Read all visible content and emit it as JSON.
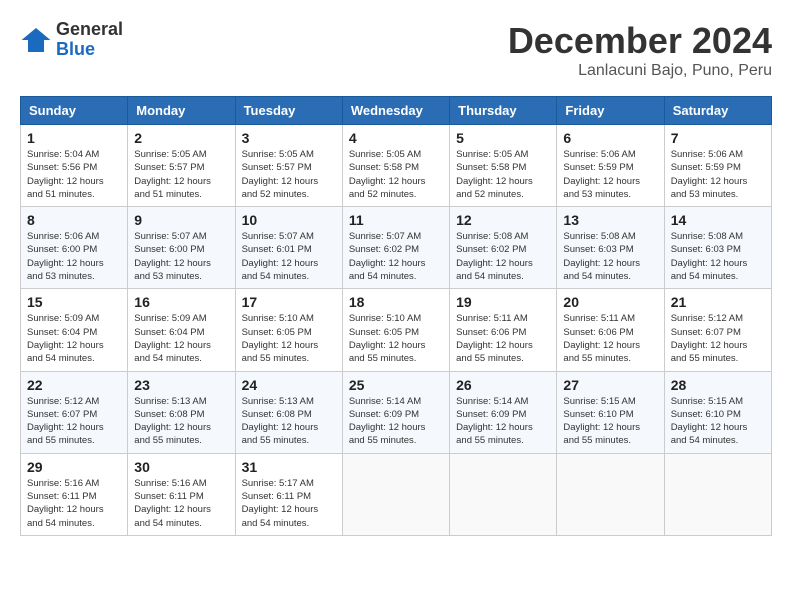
{
  "logo": {
    "general": "General",
    "blue": "Blue"
  },
  "header": {
    "month": "December 2024",
    "location": "Lanlacuni Bajo, Puno, Peru"
  },
  "weekdays": [
    "Sunday",
    "Monday",
    "Tuesday",
    "Wednesday",
    "Thursday",
    "Friday",
    "Saturday"
  ],
  "weeks": [
    [
      {
        "day": "1",
        "sunrise": "5:04 AM",
        "sunset": "5:56 PM",
        "daylight": "12 hours and 51 minutes."
      },
      {
        "day": "2",
        "sunrise": "5:05 AM",
        "sunset": "5:57 PM",
        "daylight": "12 hours and 51 minutes."
      },
      {
        "day": "3",
        "sunrise": "5:05 AM",
        "sunset": "5:57 PM",
        "daylight": "12 hours and 52 minutes."
      },
      {
        "day": "4",
        "sunrise": "5:05 AM",
        "sunset": "5:58 PM",
        "daylight": "12 hours and 52 minutes."
      },
      {
        "day": "5",
        "sunrise": "5:05 AM",
        "sunset": "5:58 PM",
        "daylight": "12 hours and 52 minutes."
      },
      {
        "day": "6",
        "sunrise": "5:06 AM",
        "sunset": "5:59 PM",
        "daylight": "12 hours and 53 minutes."
      },
      {
        "day": "7",
        "sunrise": "5:06 AM",
        "sunset": "5:59 PM",
        "daylight": "12 hours and 53 minutes."
      }
    ],
    [
      {
        "day": "8",
        "sunrise": "5:06 AM",
        "sunset": "6:00 PM",
        "daylight": "12 hours and 53 minutes."
      },
      {
        "day": "9",
        "sunrise": "5:07 AM",
        "sunset": "6:00 PM",
        "daylight": "12 hours and 53 minutes."
      },
      {
        "day": "10",
        "sunrise": "5:07 AM",
        "sunset": "6:01 PM",
        "daylight": "12 hours and 54 minutes."
      },
      {
        "day": "11",
        "sunrise": "5:07 AM",
        "sunset": "6:02 PM",
        "daylight": "12 hours and 54 minutes."
      },
      {
        "day": "12",
        "sunrise": "5:08 AM",
        "sunset": "6:02 PM",
        "daylight": "12 hours and 54 minutes."
      },
      {
        "day": "13",
        "sunrise": "5:08 AM",
        "sunset": "6:03 PM",
        "daylight": "12 hours and 54 minutes."
      },
      {
        "day": "14",
        "sunrise": "5:08 AM",
        "sunset": "6:03 PM",
        "daylight": "12 hours and 54 minutes."
      }
    ],
    [
      {
        "day": "15",
        "sunrise": "5:09 AM",
        "sunset": "6:04 PM",
        "daylight": "12 hours and 54 minutes."
      },
      {
        "day": "16",
        "sunrise": "5:09 AM",
        "sunset": "6:04 PM",
        "daylight": "12 hours and 54 minutes."
      },
      {
        "day": "17",
        "sunrise": "5:10 AM",
        "sunset": "6:05 PM",
        "daylight": "12 hours and 55 minutes."
      },
      {
        "day": "18",
        "sunrise": "5:10 AM",
        "sunset": "6:05 PM",
        "daylight": "12 hours and 55 minutes."
      },
      {
        "day": "19",
        "sunrise": "5:11 AM",
        "sunset": "6:06 PM",
        "daylight": "12 hours and 55 minutes."
      },
      {
        "day": "20",
        "sunrise": "5:11 AM",
        "sunset": "6:06 PM",
        "daylight": "12 hours and 55 minutes."
      },
      {
        "day": "21",
        "sunrise": "5:12 AM",
        "sunset": "6:07 PM",
        "daylight": "12 hours and 55 minutes."
      }
    ],
    [
      {
        "day": "22",
        "sunrise": "5:12 AM",
        "sunset": "6:07 PM",
        "daylight": "12 hours and 55 minutes."
      },
      {
        "day": "23",
        "sunrise": "5:13 AM",
        "sunset": "6:08 PM",
        "daylight": "12 hours and 55 minutes."
      },
      {
        "day": "24",
        "sunrise": "5:13 AM",
        "sunset": "6:08 PM",
        "daylight": "12 hours and 55 minutes."
      },
      {
        "day": "25",
        "sunrise": "5:14 AM",
        "sunset": "6:09 PM",
        "daylight": "12 hours and 55 minutes."
      },
      {
        "day": "26",
        "sunrise": "5:14 AM",
        "sunset": "6:09 PM",
        "daylight": "12 hours and 55 minutes."
      },
      {
        "day": "27",
        "sunrise": "5:15 AM",
        "sunset": "6:10 PM",
        "daylight": "12 hours and 55 minutes."
      },
      {
        "day": "28",
        "sunrise": "5:15 AM",
        "sunset": "6:10 PM",
        "daylight": "12 hours and 54 minutes."
      }
    ],
    [
      {
        "day": "29",
        "sunrise": "5:16 AM",
        "sunset": "6:11 PM",
        "daylight": "12 hours and 54 minutes."
      },
      {
        "day": "30",
        "sunrise": "5:16 AM",
        "sunset": "6:11 PM",
        "daylight": "12 hours and 54 minutes."
      },
      {
        "day": "31",
        "sunrise": "5:17 AM",
        "sunset": "6:11 PM",
        "daylight": "12 hours and 54 minutes."
      },
      null,
      null,
      null,
      null
    ]
  ],
  "labels": {
    "sunrise": "Sunrise: ",
    "sunset": "Sunset: ",
    "daylight": "Daylight: "
  }
}
